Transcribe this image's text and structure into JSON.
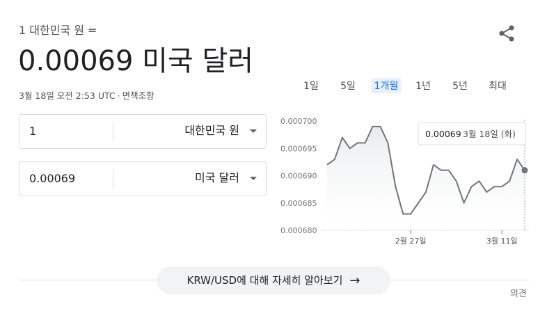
{
  "header": {
    "subtitle": "1 대한민국 원 =",
    "big_value": "0.00069 미국 달러",
    "timestamp": "3월 18일 오전 2:53 UTC",
    "separator": "·",
    "disclaimer": "면책조항"
  },
  "converter": {
    "from": {
      "value": "1",
      "currency": "대한민국 원"
    },
    "to": {
      "value": "0.00069",
      "currency": "미국 달러"
    }
  },
  "tabs": [
    {
      "label": "1일",
      "active": false
    },
    {
      "label": "5일",
      "active": false
    },
    {
      "label": "1개월",
      "active": true
    },
    {
      "label": "1년",
      "active": false
    },
    {
      "label": "5년",
      "active": false
    },
    {
      "label": "최대",
      "active": false
    }
  ],
  "tooltip": {
    "value": "0.00069",
    "date": "3월 18일 (화)"
  },
  "chart_data": {
    "type": "area",
    "ylim": [
      0.00068,
      0.0007
    ],
    "yticks": [
      "0.000700",
      "0.000695",
      "0.000690",
      "0.000685",
      "0.000680"
    ],
    "yticks_values": [
      0.0007,
      0.000695,
      0.00069,
      0.000685,
      0.00068
    ],
    "xticks": [
      {
        "index": 11,
        "label": "2월 27일"
      },
      {
        "index": 23,
        "label": "3월 11일"
      }
    ],
    "series": [
      {
        "values": [
          0.000692,
          0.000693,
          0.000697,
          0.000695,
          0.000696,
          0.000696,
          0.000699,
          0.000699,
          0.000696,
          0.000688,
          0.000683,
          0.000683,
          0.000685,
          0.000687,
          0.000692,
          0.000691,
          0.000691,
          0.000689,
          0.000685,
          0.000688,
          0.000689,
          0.000687,
          0.000688,
          0.000688,
          0.000689,
          0.000693,
          0.000691
        ]
      }
    ],
    "line_color": "#70757a",
    "fill_color": "#e8eaed",
    "grid": false
  },
  "more_button": {
    "label": "KRW/USD에 대해 자세히 알아보기",
    "arrow": "→"
  },
  "feedback": "의견",
  "icons": {
    "share": "share-icon",
    "dropdown": "caret-down-icon",
    "arrow": "arrow-right-icon"
  }
}
